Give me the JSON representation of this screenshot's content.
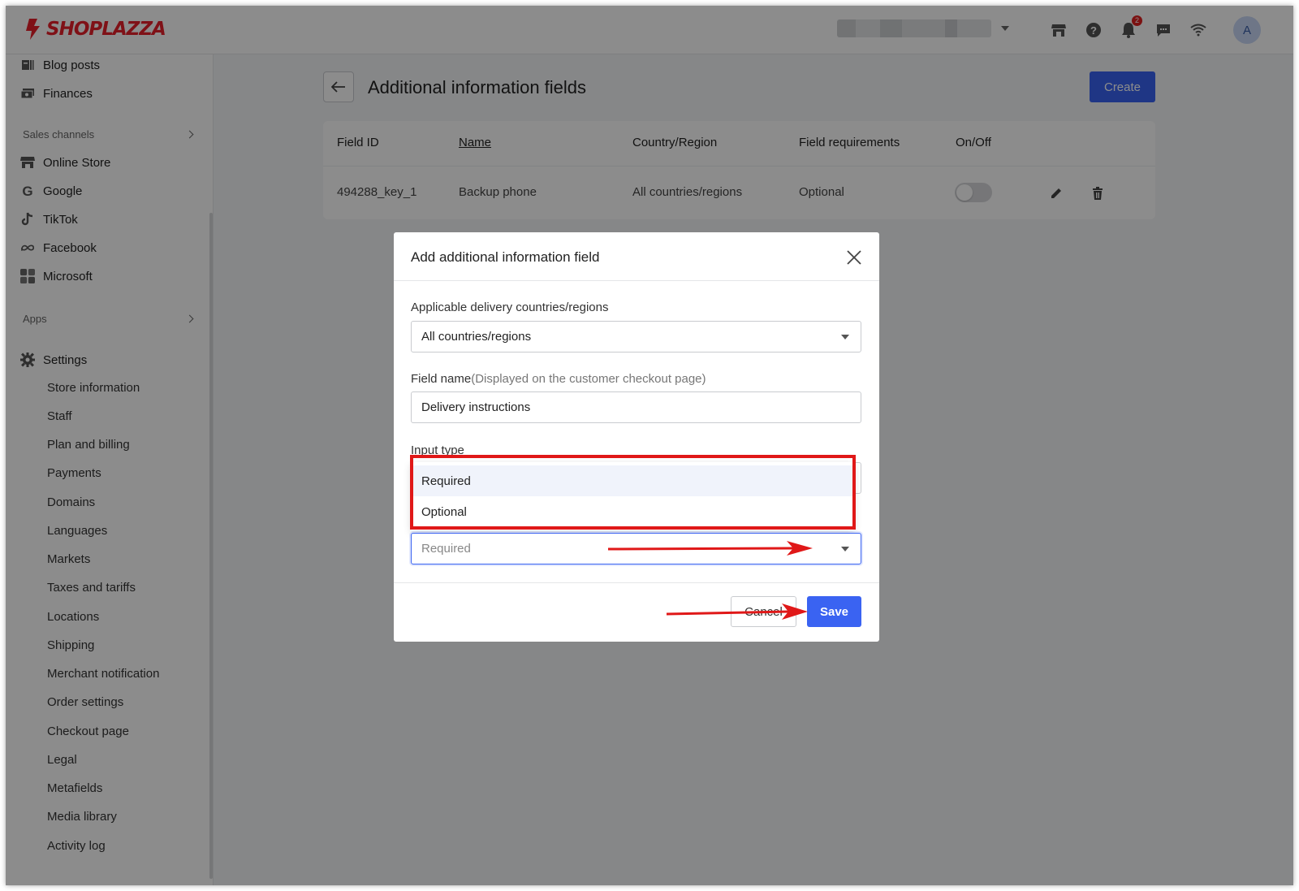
{
  "brand": {
    "name": "SHOPLAZZA",
    "color": "#e8202a",
    "accent": "#3a63f2"
  },
  "topbar": {
    "icons": [
      "store-icon",
      "help-icon",
      "bell-icon",
      "chat-icon",
      "wifi-icon"
    ],
    "notification_count": "2",
    "avatar_initial": "A"
  },
  "sidebar": {
    "top_items": [
      {
        "label": "Blog posts",
        "icon": "blog-icon"
      },
      {
        "label": "Finances",
        "icon": "finances-icon"
      }
    ],
    "sales_channels_label": "Sales channels",
    "channels": [
      {
        "label": "Online Store",
        "icon": "store-icon"
      },
      {
        "label": "Google",
        "icon": "google-icon"
      },
      {
        "label": "TikTok",
        "icon": "tiktok-icon"
      },
      {
        "label": "Facebook",
        "icon": "meta-icon"
      },
      {
        "label": "Microsoft",
        "icon": "microsoft-icon"
      }
    ],
    "apps_label": "Apps",
    "settings_label": "Settings",
    "settings_items": [
      "Store information",
      "Staff",
      "Plan and billing",
      "Payments",
      "Domains",
      "Languages",
      "Markets",
      "Taxes and tariffs",
      "Locations",
      "Shipping",
      "Merchant notification",
      "Order settings",
      "Checkout page",
      "Legal",
      "Metafields",
      "Media library",
      "Activity log"
    ]
  },
  "page": {
    "title": "Additional information fields",
    "create_label": "Create"
  },
  "table": {
    "headers": [
      "Field ID",
      "Name",
      "Country/Region",
      "Field requirements",
      "On/Off"
    ],
    "rows": [
      {
        "field_id": "494288_key_1",
        "name": "Backup phone",
        "country": "All countries/regions",
        "requirement": "Optional",
        "enabled": false
      }
    ]
  },
  "modal": {
    "title": "Add additional information field",
    "countries_label": "Applicable delivery countries/regions",
    "countries_value": "All countries/regions",
    "field_name_label": "Field name",
    "field_name_hint": "(Displayed on the customer checkout page)",
    "field_name_value": "Delivery instructions",
    "input_type_label": "Input type",
    "requirement_options": [
      "Required",
      "Optional"
    ],
    "requirement_value": "Required",
    "cancel_label": "Cancel",
    "save_label": "Save"
  }
}
